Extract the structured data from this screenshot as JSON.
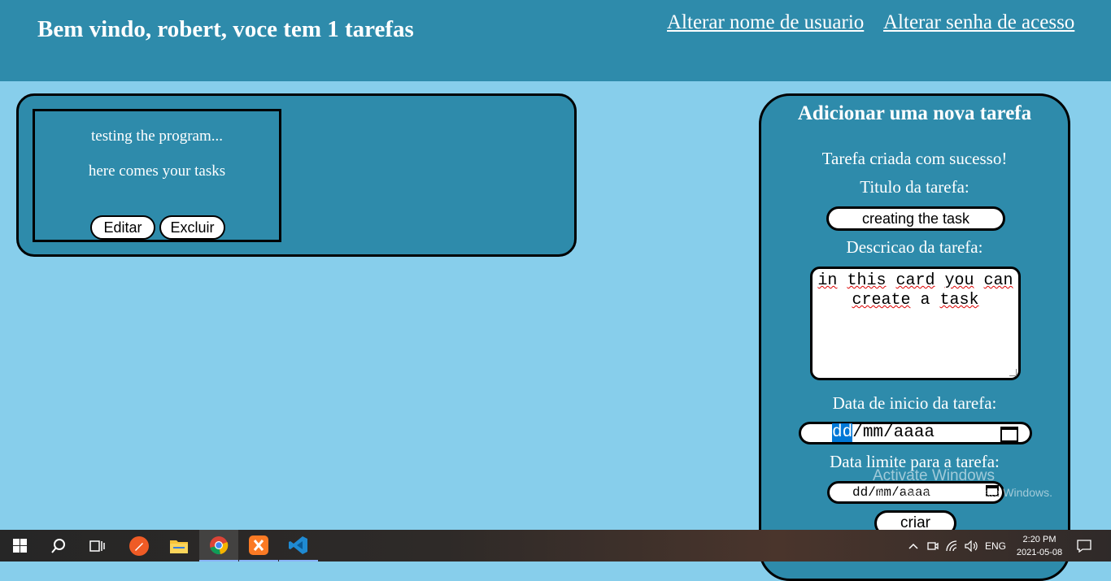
{
  "header": {
    "greeting": "Bem vindo, robert, voce tem 1 tarefas",
    "change_username": "Alterar nome de usuario",
    "change_password": "Alterar senha de acesso"
  },
  "tasks": [
    {
      "title": "testing the program...",
      "description": "here comes your tasks",
      "edit_label": "Editar",
      "delete_label": "Excluir"
    }
  ],
  "form": {
    "heading": "Adicionar uma nova tarefa",
    "success_message": "Tarefa criada com sucesso!",
    "title_label": "Titulo da tarefa:",
    "title_value": "creating the task",
    "description_label": "Descricao da tarefa:",
    "description_value_line1": [
      "in",
      "this",
      "card",
      "you",
      "can"
    ],
    "description_value_line2": [
      "create",
      "a",
      "task"
    ],
    "start_label": "Data de inicio da tarefa:",
    "start_placeholder_day": "dd",
    "start_placeholder_rest": "/mm/aaaa",
    "end_label": "Data limite para a tarefa:",
    "end_placeholder": "dd/mm/aaaa",
    "submit_label": "criar"
  },
  "watermark": {
    "title": "Activate Windows",
    "subtitle": "Go to Settings to activate Windows."
  },
  "taskbar": {
    "apps": [
      "start-icon",
      "search-icon",
      "task-view-icon",
      "postman-icon",
      "file-explorer-icon",
      "chrome-icon",
      "xampp-icon",
      "vscode-icon"
    ],
    "language": "ENG",
    "time": "2:20 PM",
    "date": "2021-05-08"
  },
  "colors": {
    "page_background": "#87ceeb",
    "panel": "#2e8bab",
    "selection": "#0078d7"
  }
}
